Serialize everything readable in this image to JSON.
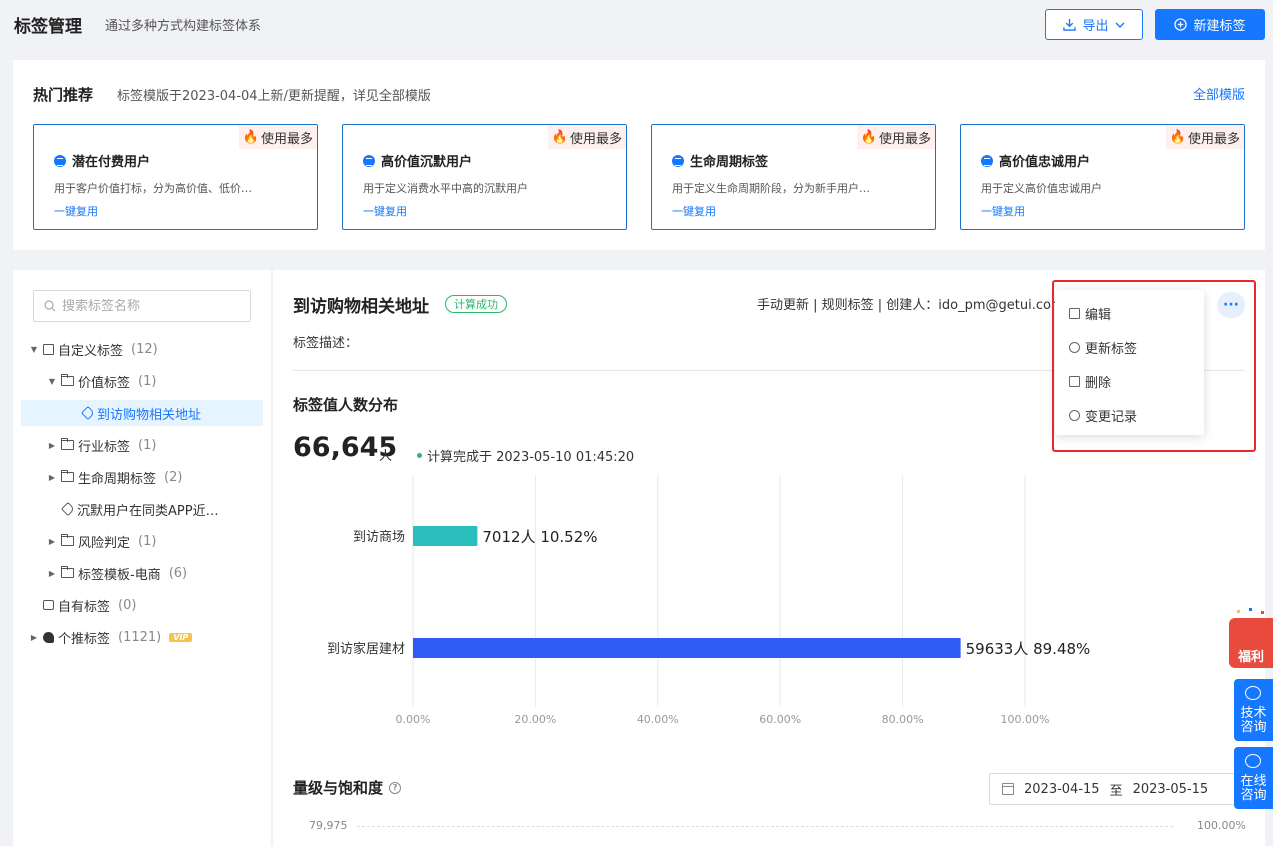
{
  "header": {
    "title": "标签管理",
    "subtitle": "通过多种方式构建标签体系",
    "export_label": "导出",
    "new_label": "新建标签"
  },
  "hot": {
    "title": "热门推荐",
    "subtitle": "标签模版于2023-04-04上新/更新提醒，详见全部模版",
    "all_link": "全部模版",
    "badge": "使用最多",
    "reuse": "一键复用",
    "cards": [
      {
        "title": "潜在付费用户",
        "desc": "用于客户价值打标，分为高价值、低价…"
      },
      {
        "title": "高价值沉默用户",
        "desc": "用于定义消费水平中高的沉默用户"
      },
      {
        "title": "生命周期标签",
        "desc": "用于定义生命周期阶段，分为新手用户…"
      },
      {
        "title": "高价值忠诚用户",
        "desc": "用于定义高价值忠诚用户"
      }
    ]
  },
  "sidebar": {
    "search_placeholder": "搜索标签名称",
    "tree": [
      {
        "label": "自定义标签",
        "count": "(12)"
      },
      {
        "label": "价值标签",
        "count": "(1)"
      },
      {
        "label": "到访购物相关地址",
        "count": ""
      },
      {
        "label": "行业标签",
        "count": "(1)"
      },
      {
        "label": "生命周期标签",
        "count": "(2)"
      },
      {
        "label": "沉默用户在同类APP近…",
        "count": ""
      },
      {
        "label": "风险判定",
        "count": "(1)"
      },
      {
        "label": "标签模板-电商",
        "count": "(6)"
      },
      {
        "label": "自有标签",
        "count": "(0)"
      },
      {
        "label": "个推标签",
        "count": "(1121)"
      }
    ],
    "vip": "VIP"
  },
  "detail": {
    "name": "到访购物相关地址",
    "status": "计算成功",
    "meta": "手动更新 | 规则标签 | 创建人：ido_pm@getui.com",
    "more": "···",
    "desc_label": "标签描述：",
    "dist_title": "标签值人数分布",
    "total": "66,645",
    "total_unit": "人",
    "calc_time": "计算完成于 2023-05-10 01:45:20",
    "sec2_title": "量级与饱和度",
    "date_from": "2023-04-15",
    "date_sep": "至",
    "date_to": "2023-05-15",
    "y_left": "79,975",
    "y_right": "100.00%"
  },
  "menu": {
    "items": [
      "编辑",
      "更新标签",
      "删除",
      "变更记录"
    ]
  },
  "floats": {
    "gift": "福利",
    "tech": "技术咨询",
    "online": "在线咨询"
  },
  "colors": {
    "primary": "#1677ff",
    "bar_teal": "#2cbdbd",
    "bar_blue": "#2f5bf5",
    "highlight": "#e8292c"
  },
  "chart_data": {
    "type": "bar",
    "orientation": "horizontal",
    "categories": [
      "到访商场",
      "到访家居建材"
    ],
    "values": [
      7012,
      59633
    ],
    "percents": [
      10.52,
      89.48
    ],
    "data_labels": [
      "7012人 10.52%",
      "59633人 89.48%"
    ],
    "xlim": [
      0,
      100
    ],
    "x_ticks": [
      "0.00%",
      "20.00%",
      "40.00%",
      "60.00%",
      "80.00%",
      "100.00%"
    ],
    "grid": true,
    "colors": [
      "#2cbdbd",
      "#2f5bf5"
    ]
  }
}
